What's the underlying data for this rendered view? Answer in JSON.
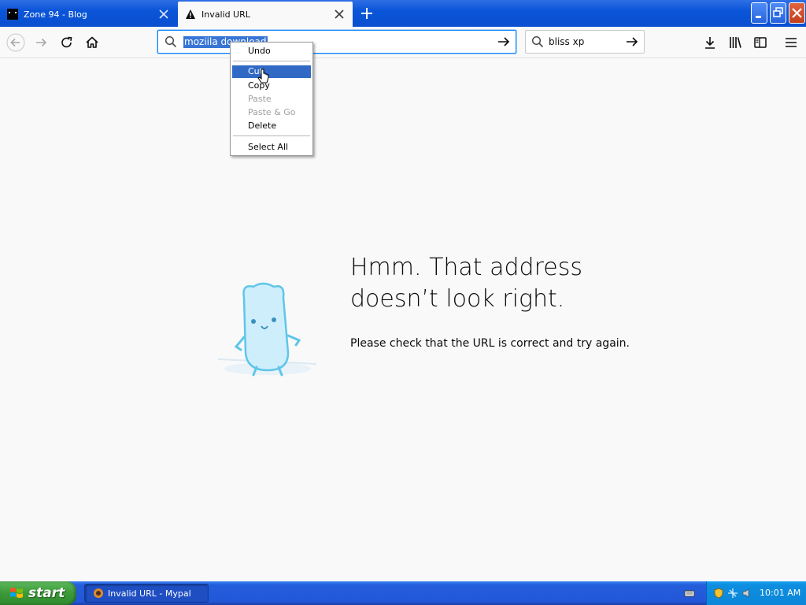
{
  "tabs": [
    {
      "title": "Zone 94 - Blog",
      "active": false,
      "icon": "zone94-favicon"
    },
    {
      "title": "Invalid URL",
      "active": true,
      "icon": "warning-icon"
    }
  ],
  "navigation": {
    "url_value": "moziila download",
    "search_value": "bliss xp"
  },
  "context_menu": {
    "items": [
      {
        "label": "Undo",
        "enabled": true
      },
      {
        "label": "Cut",
        "enabled": true,
        "highlighted": true
      },
      {
        "label": "Copy",
        "enabled": true
      },
      {
        "label": "Paste",
        "enabled": false
      },
      {
        "label": "Paste & Go",
        "enabled": false
      },
      {
        "label": "Delete",
        "enabled": true
      },
      {
        "label": "Select All",
        "enabled": true
      }
    ]
  },
  "error_page": {
    "title": "Hmm. That address doesn’t look right.",
    "description": "Please check that the URL is correct and try again."
  },
  "taskbar": {
    "start_label": "start",
    "task_label": "Invalid URL - Mypal",
    "clock": "10:01 AM"
  },
  "colors": {
    "accent": "#0a84ff",
    "selection": "#316ac5",
    "xp_blue": "#245edb",
    "xp_green": "#3c9a3a"
  }
}
